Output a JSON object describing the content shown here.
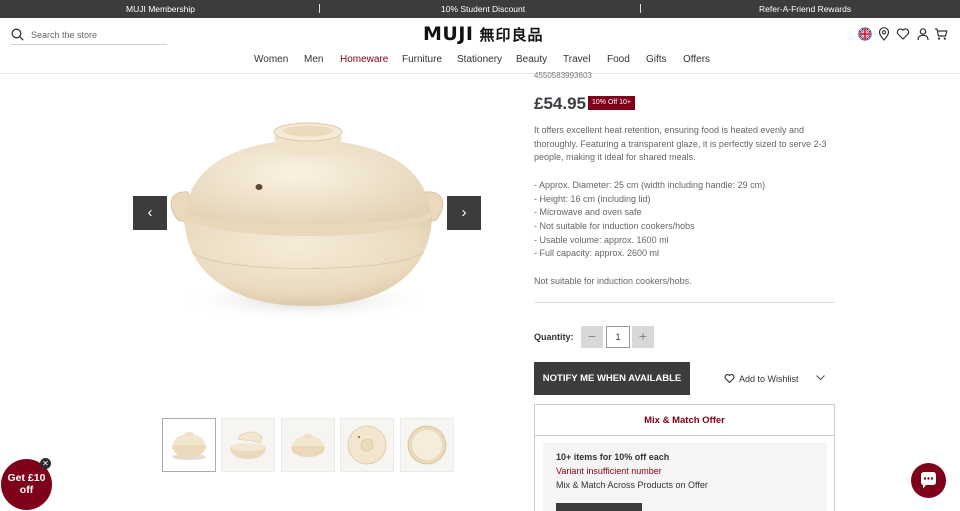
{
  "promo_bar": {
    "membership": "MUJI Membership",
    "student": "10% Student Discount",
    "referral": "Refer-A-Friend Rewards"
  },
  "header": {
    "search_placeholder": "Search the store",
    "logo": "MUJI",
    "logo_jp": "無印良品",
    "icons": [
      "uk-flag-icon",
      "location-icon",
      "heart-icon",
      "account-icon",
      "cart-icon"
    ]
  },
  "nav": {
    "items": [
      "Women",
      "Men",
      "Homeware",
      "Furniture",
      "Stationery",
      "Beauty",
      "Travel",
      "Food",
      "Gifts",
      "Offers"
    ],
    "active": "Homeware"
  },
  "gallery": {
    "prev": "‹",
    "next": "›",
    "thumb_count": 5,
    "active_thumb": 0
  },
  "product": {
    "code": "4550583993603",
    "price": "£54.95",
    "badge": "10% Off 10+",
    "description": [
      "It offers excellent heat retention, ensuring food is heated evenly and",
      "thoroughly. Featuring a transparent glaze, it is perfectly sized to serve 2-3",
      "people, making it ideal for shared meals.",
      "",
      "- Approx. Diameter: 25 cm (width including handle: 29 cm)",
      "- Height: 16 cm (including lid)",
      "- Microwave and oven safe",
      "- Not suitable for induction cookers/hobs",
      "- Usable volume: approx. 1600 ml",
      "- Full capacity: approx. 2600 ml",
      "",
      "Not suitable for induction cookers/hobs."
    ]
  },
  "purchase": {
    "quantity_label": "Quantity:",
    "quantity": "1",
    "minus": "−",
    "plus": "+",
    "notify_label": "NOTIFY ME WHEN AVAILABLE",
    "wishlist_label": "Add to Wishlist"
  },
  "offer": {
    "title": "Mix & Match Offer",
    "headline": "10+ items for 10% off each",
    "status": "Variant insufficient number",
    "note": "Mix & Match Across Products on Offer"
  },
  "floating": {
    "promo_line1": "Get £10",
    "promo_line2": "off",
    "promo_close": "✕"
  },
  "colors": {
    "brand": "#7f0019",
    "dark": "#3c3c3c"
  }
}
